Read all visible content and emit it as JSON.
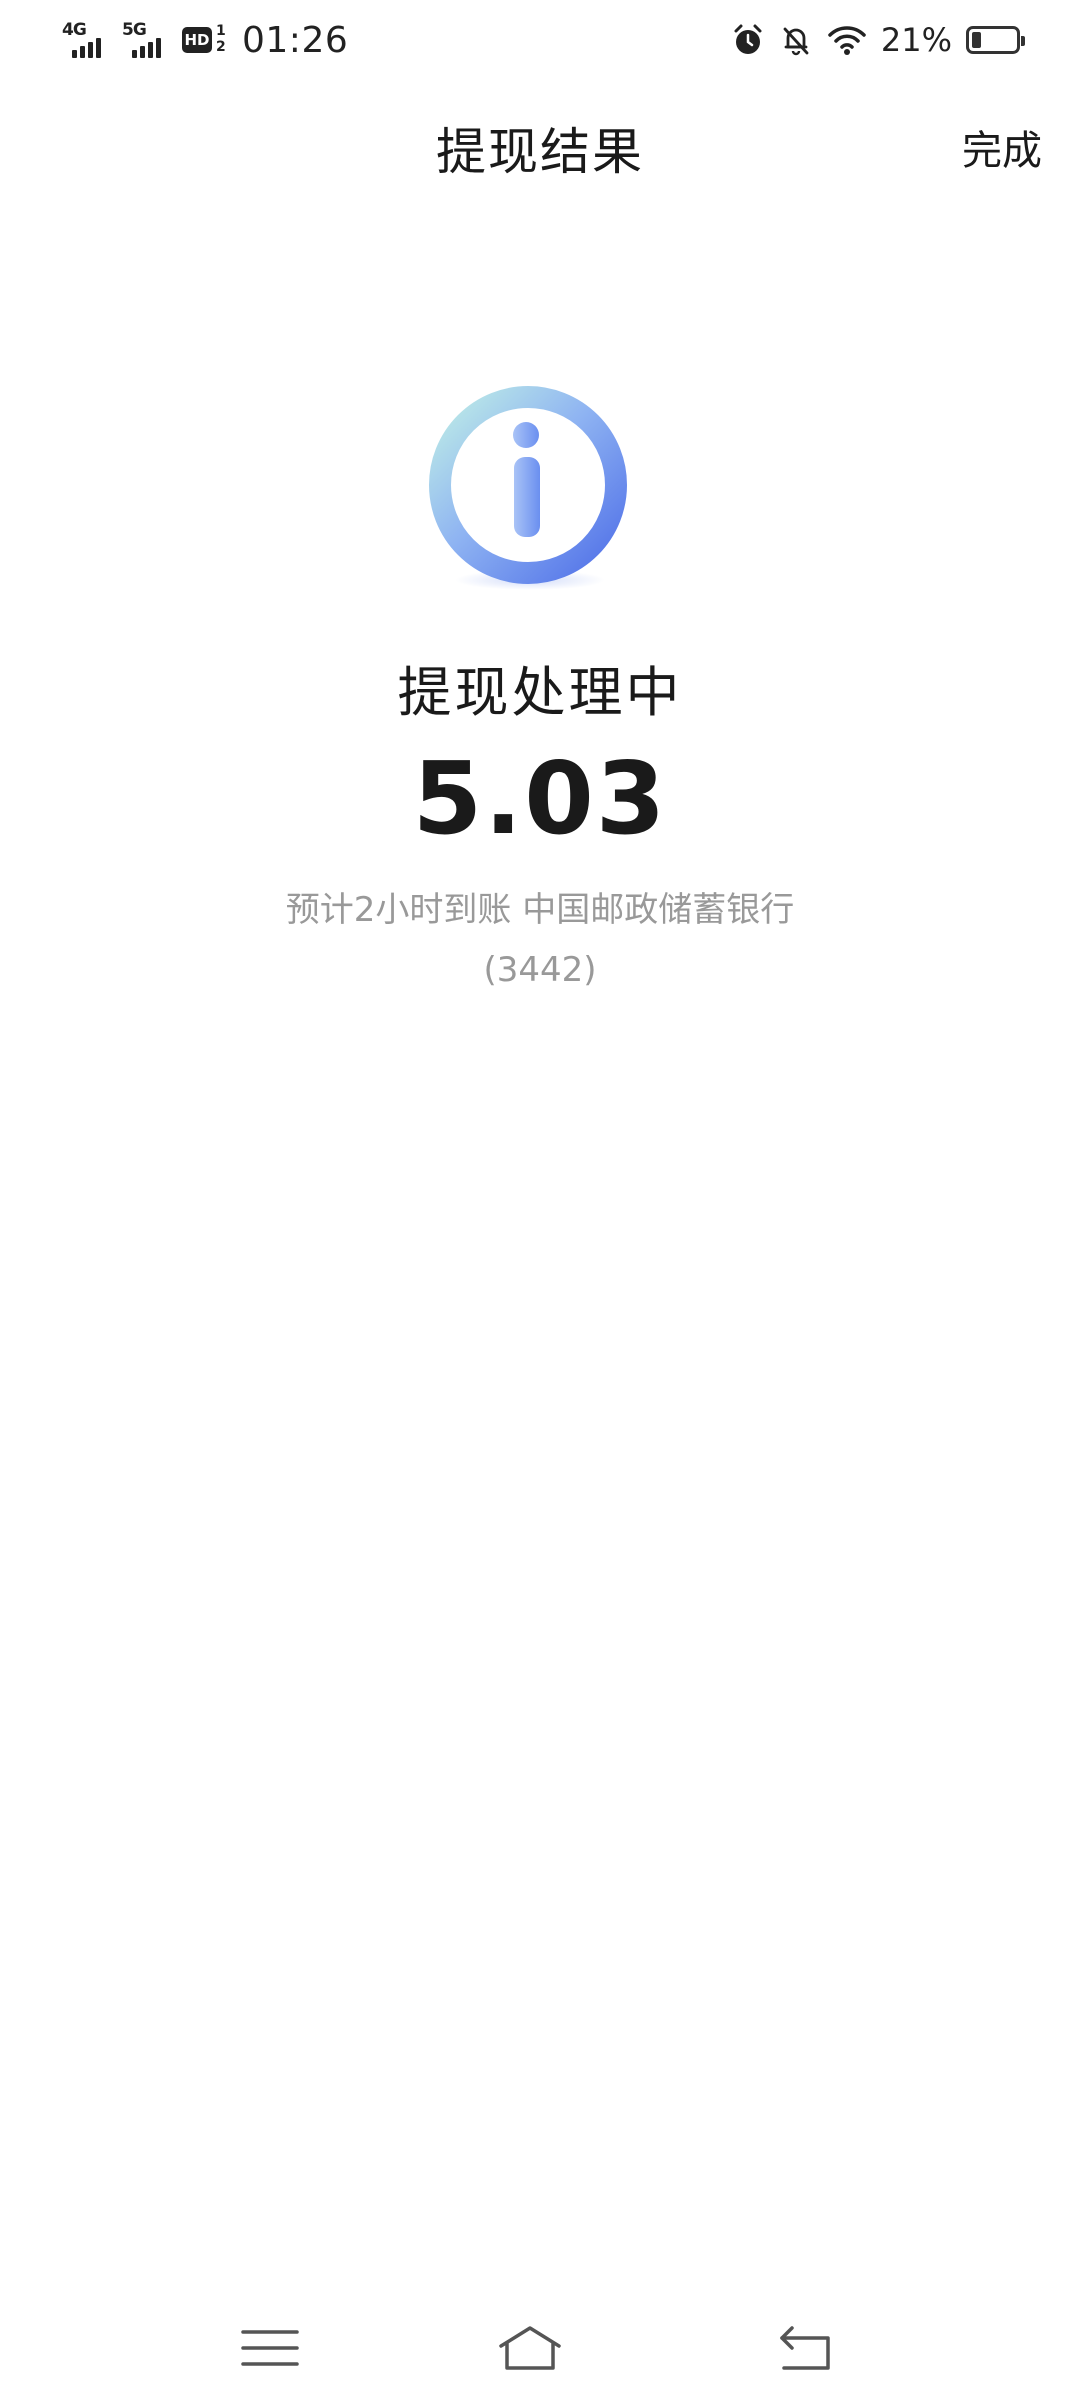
{
  "status_bar": {
    "sim1_network": "4G",
    "sim2_network": "5G",
    "hd_label": "HD",
    "hd_sub_top": "1",
    "hd_sub_bottom": "2",
    "time": "01:26",
    "battery_text": "21%",
    "battery_level": 0.21,
    "icons": [
      "alarm-icon",
      "bell-off-icon",
      "wifi-icon",
      "battery-icon"
    ]
  },
  "header": {
    "title": "提现结果",
    "done_label": "完成"
  },
  "result": {
    "icon": "info-icon",
    "status_text": "提现处理中",
    "amount": "5.03",
    "desc_line1": "预计2小时到账 中国邮政储蓄银行",
    "desc_line2": "(3442)"
  },
  "nav_bar": {
    "icons": [
      "menu-icon",
      "home-icon",
      "back-icon"
    ]
  },
  "colors": {
    "accent_blue": "#5b7ff0",
    "text_primary": "#1a1a1a",
    "text_secondary": "#999999"
  }
}
